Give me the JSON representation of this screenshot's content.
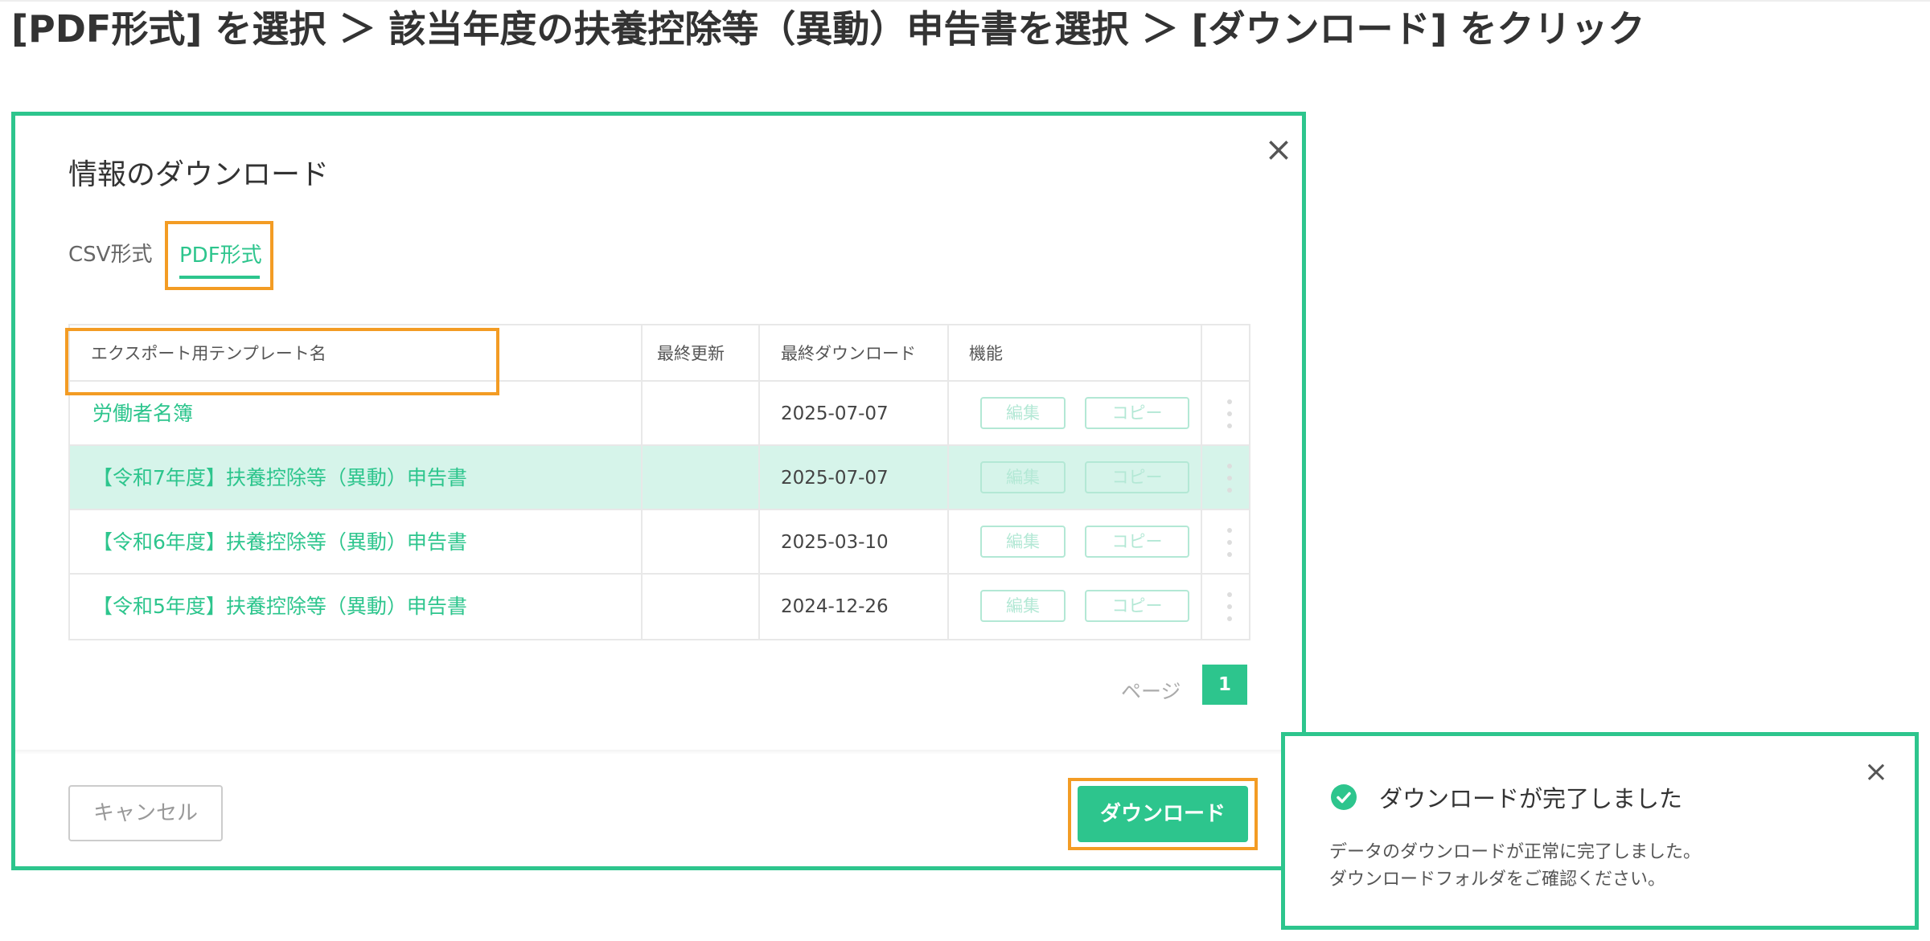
{
  "instruction": "[PDF形式] を選択 ＞ 該当年度の扶養控除等（異動）申告書を選択 ＞ [ダウンロード] をクリック",
  "modal": {
    "title": "情報のダウンロード",
    "close_icon": "×",
    "tabs": [
      {
        "label": "CSV形式",
        "active": false
      },
      {
        "label": "PDF形式",
        "active": true
      }
    ],
    "table": {
      "headers": [
        "エクスポート用テンプレート名",
        "最終更新",
        "最終ダウンロード",
        "機能"
      ],
      "rows": [
        {
          "name": "労働者名簿",
          "last_updated": "",
          "last_download": "2025-07-07",
          "edit_label": "編集",
          "copy_label": "コピー",
          "selected": false
        },
        {
          "name": "【令和7年度】扶養控除等（異動）申告書",
          "last_updated": "",
          "last_download": "2025-07-07",
          "edit_label": "編集",
          "copy_label": "コピー",
          "selected": true
        },
        {
          "name": "【令和6年度】扶養控除等（異動）申告書",
          "last_updated": "",
          "last_download": "2025-03-10",
          "edit_label": "編集",
          "copy_label": "コピー",
          "selected": false
        },
        {
          "name": "【令和5年度】扶養控除等（異動）申告書",
          "last_updated": "",
          "last_download": "2024-12-26",
          "edit_label": "編集",
          "copy_label": "コピー",
          "selected": false
        }
      ]
    },
    "pagination": {
      "label": "ページ",
      "current": "1"
    },
    "footer": {
      "cancel_label": "キャンセル",
      "download_label": "ダウンロード"
    }
  },
  "notification": {
    "title": "ダウンロードが完了しました",
    "line1": "データのダウンロードが正常に完了しました。",
    "line2": "ダウンロードフォルダをご確認ください。",
    "close_icon": "×"
  },
  "colors": {
    "accent": "#2dc58d",
    "highlight": "#f39c24",
    "selected_row": "#d6f4ea"
  }
}
